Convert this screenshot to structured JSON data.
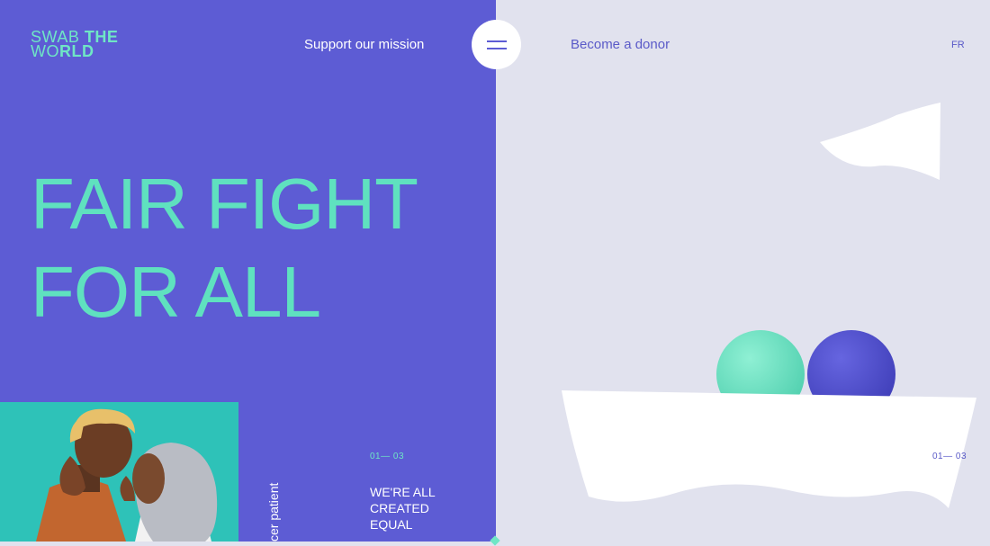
{
  "logo": {
    "line1_light": "SWAB",
    "line1_bold": "THE",
    "line2_light": "WO",
    "line2_bold": "RLD"
  },
  "nav": {
    "left_link": "Support our mission",
    "right_link": "Become a donor",
    "language": "FR",
    "menu_icon": "hamburger-icon"
  },
  "hero": {
    "headline_line1": "FAIR FIGHT",
    "headline_line2": "FOR ALL"
  },
  "slide": {
    "counter_left": "01— 03",
    "counter_right": "01— 03",
    "vertical_caption": "cer patient",
    "subtitle_line1": "WE'RE ALL",
    "subtitle_line2": "CREATED",
    "subtitle_line3": "EQUAL"
  },
  "colors": {
    "left_panel": "#5d5cd4",
    "right_panel": "#e1e2ee",
    "accent_mint": "#5fe1bf",
    "photo_bg": "#2ec2b8",
    "ball_mint": "#6fe1c4",
    "ball_blue": "#4f4ec8"
  }
}
